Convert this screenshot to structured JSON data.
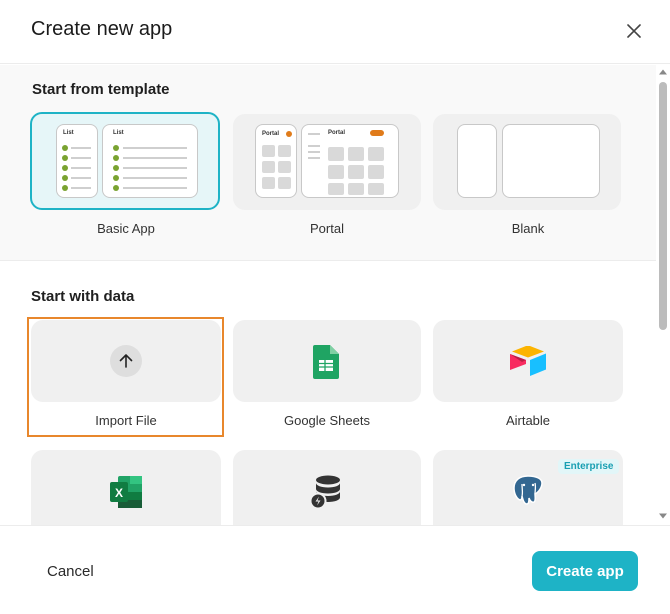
{
  "dialog": {
    "title": "Create new app"
  },
  "templates": {
    "heading": "Start from template",
    "items": [
      {
        "label": "Basic App",
        "preview_left_label": "List",
        "preview_right_label": "List",
        "selected": true
      },
      {
        "label": "Portal",
        "preview_left_label": "Portal",
        "preview_right_label": "Portal",
        "selected": false
      },
      {
        "label": "Blank",
        "selected": false
      }
    ]
  },
  "data_sources": {
    "heading": "Start with data",
    "items": [
      {
        "label": "Import File",
        "icon": "upload-arrow-icon",
        "focused": true
      },
      {
        "label": "Google Sheets",
        "icon": "google-sheets-icon"
      },
      {
        "label": "Airtable",
        "icon": "airtable-icon"
      },
      {
        "label": "",
        "icon": "excel-icon"
      },
      {
        "label": "",
        "icon": "database-icon"
      },
      {
        "label": "",
        "icon": "postgresql-icon",
        "badge": "Enterprise"
      }
    ]
  },
  "footer": {
    "cancel_label": "Cancel",
    "create_label": "Create app"
  },
  "colors": {
    "accent": "#1eb3c6",
    "focus": "#e8872c",
    "list_dot": "#7aa331",
    "portal_dot": "#e07b1a"
  }
}
